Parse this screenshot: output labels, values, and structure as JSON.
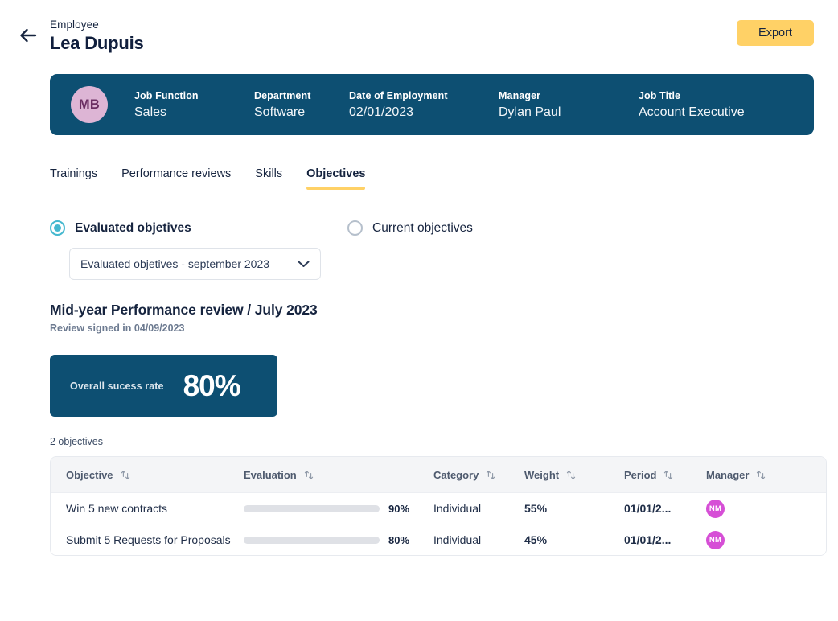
{
  "header": {
    "back_icon": "arrow-left-icon",
    "eyebrow": "Employee",
    "title": "Lea Dupuis",
    "export_label": "Export"
  },
  "info_card": {
    "avatar_initials": "MB",
    "fields": [
      {
        "label": "Job Function",
        "value": "Sales"
      },
      {
        "label": "Department",
        "value": "Software"
      },
      {
        "label": "Date of Employment",
        "value": "02/01/2023"
      },
      {
        "label": "Manager",
        "value": "Dylan Paul"
      },
      {
        "label": "Job Title",
        "value": "Account Executive"
      }
    ]
  },
  "tabs": [
    {
      "label": "Trainings",
      "active": false
    },
    {
      "label": "Performance reviews",
      "active": false
    },
    {
      "label": "Skills",
      "active": false
    },
    {
      "label": "Objectives",
      "active": true
    }
  ],
  "filters": {
    "radio_options": [
      {
        "label": "Evaluated objetives",
        "selected": true
      },
      {
        "label": "Current objectives",
        "selected": false
      }
    ],
    "select": {
      "value": "Evaluated objetives - september 2023",
      "chevron_icon": "chevron-down-icon"
    }
  },
  "review": {
    "title": "Mid-year Performance review / July 2023",
    "signed": "Review signed in 04/09/2023"
  },
  "kpi": {
    "label": "Overall sucess rate",
    "value": "80%"
  },
  "table": {
    "count_label": "2 objectives",
    "columns": [
      {
        "label": "Objective",
        "sort_icon": "sort-arrows-icon"
      },
      {
        "label": "Evaluation",
        "sort_icon": "sort-arrows-icon"
      },
      {
        "label": "Category",
        "sort_icon": "sort-arrows-icon"
      },
      {
        "label": "Weight",
        "sort_icon": "sort-arrows-icon"
      },
      {
        "label": "Period",
        "sort_icon": "sort-arrows-icon"
      },
      {
        "label": "Manager",
        "sort_icon": "sort-arrows-icon"
      }
    ],
    "rows": [
      {
        "objective": "Win 5 new contracts",
        "evaluation_pct": "90%",
        "evaluation_value": 90,
        "category": "Individual",
        "weight": "55%",
        "period": "01/01/2...",
        "manager_initials": "NM"
      },
      {
        "objective": "Submit 5 Requests for Proposals",
        "evaluation_pct": "80%",
        "evaluation_value": 80,
        "category": "Individual",
        "weight": "45%",
        "period": "01/01/2...",
        "manager_initials": "NM"
      }
    ]
  },
  "colors": {
    "card_navy": "#0d4f72",
    "accent_yellow": "#ffd166",
    "radio_teal": "#45b8cf",
    "avatar_pink": "#ddb5d5",
    "avatar_magenta": "#d64fd6",
    "text_dark": "#16243f"
  }
}
